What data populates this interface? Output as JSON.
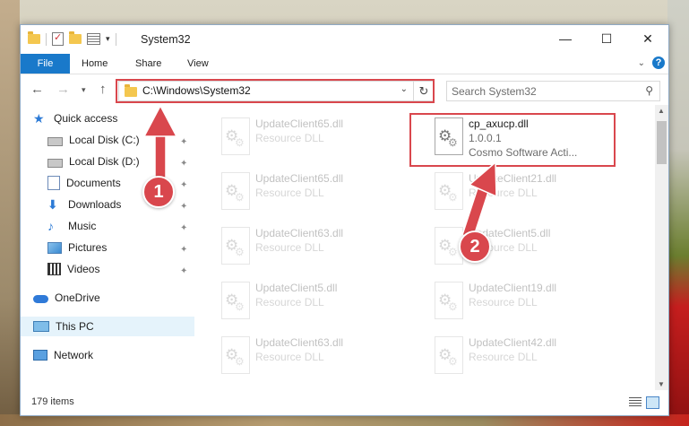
{
  "window": {
    "title": "System32"
  },
  "ribbon": {
    "tabs": [
      "File",
      "Home",
      "Share",
      "View"
    ]
  },
  "address": {
    "path": "C:\\Windows\\System32"
  },
  "search": {
    "placeholder": "Search System32"
  },
  "nav": {
    "items": [
      {
        "label": "Quick access",
        "icon": "star-icon"
      },
      {
        "label": "Local Disk (C:)",
        "icon": "disk-icon",
        "pinned": true
      },
      {
        "label": "Local Disk (D:)",
        "icon": "disk-icon",
        "pinned": true
      },
      {
        "label": "Documents",
        "icon": "documents-icon",
        "pinned": true
      },
      {
        "label": "Downloads",
        "icon": "download-icon",
        "pinned": true
      },
      {
        "label": "Music",
        "icon": "music-icon",
        "pinned": true
      },
      {
        "label": "Pictures",
        "icon": "pictures-icon",
        "pinned": true
      },
      {
        "label": "Videos",
        "icon": "videos-icon",
        "pinned": true
      },
      {
        "label": "OneDrive",
        "icon": "cloud-icon"
      },
      {
        "label": "This PC",
        "icon": "pc-icon",
        "selected": true
      },
      {
        "label": "Network",
        "icon": "network-icon"
      }
    ]
  },
  "files": {
    "left": [
      {
        "name": "UpdateClient65.dll",
        "type": "Resource DLL"
      },
      {
        "name": "UpdateClient65.dll",
        "type": "Resource DLL"
      },
      {
        "name": "UpdateClient63.dll",
        "type": "Resource DLL"
      },
      {
        "name": "UpdateClient5.dll",
        "type": "Resource DLL"
      },
      {
        "name": "UpdateClient63.dll",
        "type": "Resource DLL"
      }
    ],
    "highlighted": {
      "name": "cp_axucp.dll",
      "version": "1.0.0.1",
      "description": "Cosmo Software Acti..."
    },
    "right": [
      {
        "name": "UpdateClient21.dll",
        "type": "Resource DLL"
      },
      {
        "name": "UpdateClient5.dll",
        "type": "Resource DLL"
      },
      {
        "name": "UpdateClient19.dll",
        "type": "Resource DLL"
      },
      {
        "name": "UpdateClient42.dll",
        "type": "Resource DLL"
      }
    ]
  },
  "status": {
    "item_count": "179 items"
  },
  "callouts": [
    "1",
    "2"
  ],
  "colors": {
    "accent": "#1979ca",
    "highlight": "#d9474d"
  }
}
